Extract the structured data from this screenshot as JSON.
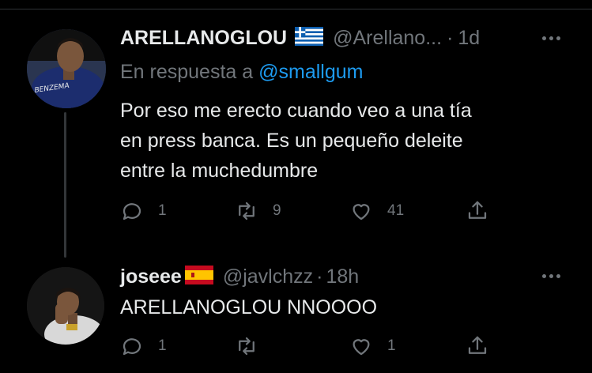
{
  "colors": {
    "background": "#000000",
    "text_primary": "#e7e9ea",
    "text_secondary": "#71767b",
    "link": "#1d9bf0"
  },
  "tweets": [
    {
      "display_name": "ARELLANOGLOU",
      "flag_icon": "greece-flag-icon",
      "handle": "@Arellano...",
      "separator": "·",
      "time": "1d",
      "reply_prefix": "En respuesta a",
      "reply_to": "@smallgum",
      "text_lines": [
        "Por eso me erecto cuando veo a una tía",
        "en press banca. Es un pequeño deleite",
        "entre la muchedumbre"
      ],
      "actions": {
        "reply_count": "1",
        "retweet_count": "9",
        "like_count": "41",
        "share_count": ""
      }
    },
    {
      "display_name": "joseee",
      "flag_icon": "spain-flag-icon",
      "handle": "@javlchzz",
      "separator": "·",
      "time": "18h",
      "text_lines": [
        "ARELLANOGLOU NNOOOO"
      ],
      "actions": {
        "reply_count": "1",
        "retweet_count": "",
        "like_count": "1",
        "share_count": ""
      }
    }
  ]
}
